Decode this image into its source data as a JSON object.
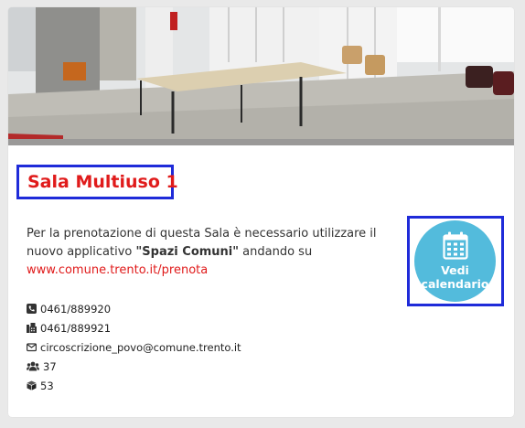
{
  "room": {
    "title": "Sala Multiuso 1",
    "description": {
      "part1": "Per la prenotazione di questa Sala è necessario utilizzare il nuovo applicativo ",
      "app_name": "\"Spazi Comuni\"",
      "part2": " andando su ",
      "link_text": "www.comune.trento.it/prenota"
    },
    "calendar_button": {
      "line1": "Vedi",
      "line2": "calendario",
      "icon": "calendar-icon"
    },
    "contacts": [
      {
        "icon": "phone-icon",
        "text": "0461/889920"
      },
      {
        "icon": "fax-icon",
        "text": "0461/889921"
      },
      {
        "icon": "envelope-icon",
        "text": "circoscrizione_povo@comune.trento.it"
      },
      {
        "icon": "users-icon",
        "text": "37"
      },
      {
        "icon": "cube-icon",
        "text": "53"
      }
    ]
  },
  "colors": {
    "title": "#e01b1b",
    "highlight_border": "#1f2bd9",
    "calendar_circle": "#53bbdc",
    "link": "#e01b1b"
  }
}
